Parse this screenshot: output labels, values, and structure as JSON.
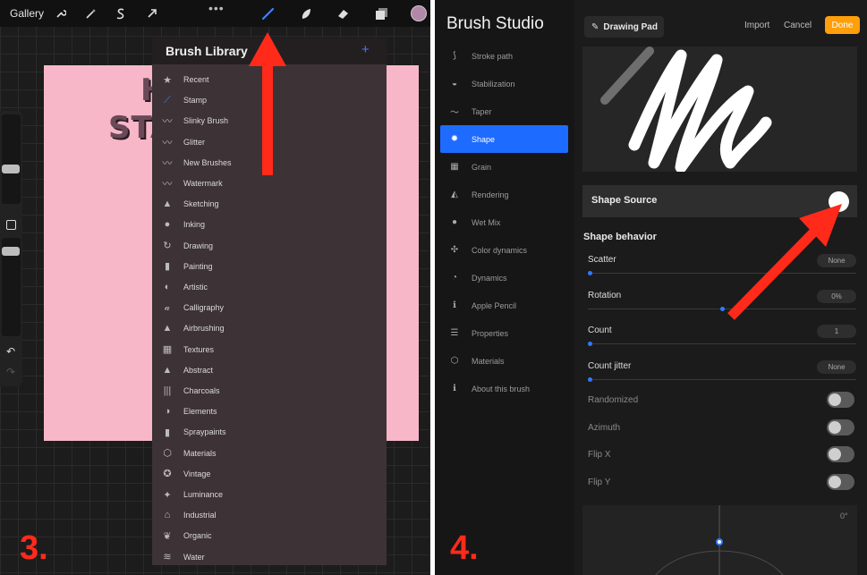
{
  "left_panel": {
    "gallery_label": "Gallery",
    "toolbar_icons": [
      "wrench-icon",
      "magic-wand-icon",
      "selection-s-icon",
      "arrow-cursor-icon",
      "brush-icon",
      "smudge-icon",
      "eraser-icon",
      "layers-icon"
    ],
    "more_dots": "•••",
    "current_color": "#b287a8",
    "canvas_text_line1": "H",
    "canvas_text_line2": "STA",
    "brush_library": {
      "title": "Brush Library",
      "add_label": "+",
      "items": [
        "Recent",
        "Stamp",
        "Slinky Brush",
        "Glitter",
        "New Brushes",
        "Watermark",
        "Sketching",
        "Inking",
        "Drawing",
        "Painting",
        "Artistic",
        "Calligraphy",
        "Airbrushing",
        "Textures",
        "Abstract",
        "Charcoals",
        "Elements",
        "Spraypaints",
        "Materials",
        "Vintage",
        "Luminance",
        "Industrial",
        "Organic",
        "Water"
      ]
    },
    "step_number": "3."
  },
  "right_panel": {
    "studio_title": "Brush Studio",
    "menu": [
      "Stroke path",
      "Stabilization",
      "Taper",
      "Shape",
      "Grain",
      "Rendering",
      "Wet Mix",
      "Color dynamics",
      "Dynamics",
      "Apple Pencil",
      "Properties",
      "Materials",
      "About this brush"
    ],
    "active_menu": "Shape",
    "drawing_pad_label": "Drawing Pad",
    "import_label": "Import",
    "cancel_label": "Cancel",
    "done_label": "Done",
    "shape_source_label": "Shape Source",
    "shape_behavior_label": "Shape behavior",
    "sliders": [
      {
        "label": "Scatter",
        "value": "None",
        "fraction": 0.0
      },
      {
        "label": "Rotation",
        "value": "0%",
        "fraction": 0.5
      },
      {
        "label": "Count",
        "value": "1",
        "fraction": 0.0
      },
      {
        "label": "Count jitter",
        "value": "None",
        "fraction": 0.0
      }
    ],
    "toggles": [
      {
        "label": "Randomized",
        "on": false
      },
      {
        "label": "Azimuth",
        "on": false
      },
      {
        "label": "Flip X",
        "on": false
      },
      {
        "label": "Flip Y",
        "on": false
      }
    ],
    "dial_degree": "0°",
    "step_number": "4."
  },
  "colors": {
    "accent_blue": "#1e6bff",
    "done_orange": "#ff9f0a",
    "annotation_red": "#ff2a1a",
    "canvas_pink": "#f7b7c9"
  }
}
